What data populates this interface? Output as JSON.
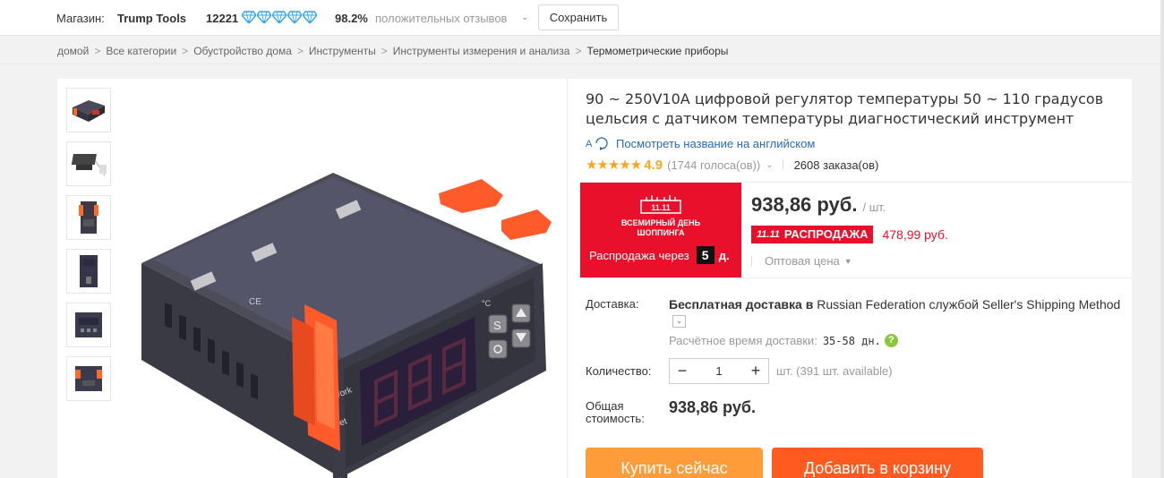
{
  "store": {
    "label": "Магазин:",
    "name": "Trump Tools",
    "score": "12221",
    "diamond_count": 5,
    "diamond_color": "#2fa4e7",
    "positive_pct": "98.2%",
    "feedback_label": "положительных отзывов",
    "save_label": "Сохранить"
  },
  "breadcrumb": {
    "items": [
      "домой",
      "Все категории",
      "Обустройство дома",
      "Инструменты",
      "Инструменты измерения и анализа"
    ],
    "current": "Термометрические приборы",
    "separator": ">"
  },
  "product": {
    "title": "90 ~ 250V10A цифровой регулятор температуры 50 ~ 110 градусов цельсия с датчиком температуры диагностический инструмент",
    "translate_link": "Посмотреть название на английском",
    "stars": "★★★★★",
    "rating": "4.9",
    "votes": "(1744 голоса(ов))",
    "orders": "2608 заказа(ов)",
    "device_labels": {
      "work": "Work",
      "set": "Set",
      "s_key": "S",
      "degree": "°C"
    }
  },
  "promo": {
    "logo_text": "11.11",
    "title_line1": "ВСЕМИРНЫЙ ДЕНЬ",
    "title_line2": "ШОППИНГА",
    "countdown_label": "Распродажа через",
    "days": "5",
    "days_unit": "д.",
    "color": "#e8102b"
  },
  "price": {
    "value": "938,86 руб.",
    "unit": "/ шт.",
    "sale_mark": "11.11",
    "sale_label": "РАСПРОДАЖА",
    "sale_price": "478,99 руб.",
    "wholesale": "Оптовая цена"
  },
  "shipping": {
    "label": "Доставка:",
    "text_bold": "Бесплатная доставка в",
    "text_rest": " Russian Federation службой Seller's Shipping Method",
    "eta_label": "Расчётное время доставки:",
    "eta_days": "35-58 дн.",
    "help": "?"
  },
  "quantity": {
    "label": "Количество:",
    "value": "1",
    "minus": "−",
    "plus": "+",
    "note": "шт. (391 шт. available)"
  },
  "total": {
    "label_line1": "Общая",
    "label_line2": "стоимость:",
    "value": "938,86 руб."
  },
  "actions": {
    "buy_now": "Купить сейчас",
    "add_to_cart": "Добавить в корзину",
    "buy_color": "#ff9c3a",
    "cart_color": "#ff5a1f"
  }
}
